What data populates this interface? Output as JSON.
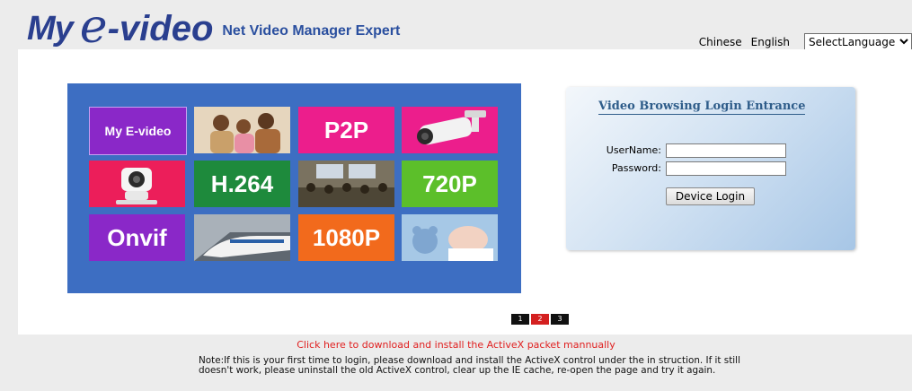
{
  "header": {
    "logo": {
      "my": "My",
      "e": "e",
      "video": "-video",
      "tagline": "Net Video Manager Expert"
    },
    "languages": [
      "Chinese",
      "English"
    ],
    "language_select": {
      "value": "SelectLanguage"
    }
  },
  "mosaic": {
    "tiles": [
      {
        "label": "My E-video",
        "color": "#8a28c8"
      },
      {
        "label": "",
        "icon": "family-photo-icon",
        "color": "#c9a07a"
      },
      {
        "label": "P2P",
        "color": "#ec1e8c"
      },
      {
        "label": "",
        "icon": "bullet-camera-icon",
        "color": "#ec1e8c"
      },
      {
        "label": "",
        "icon": "dome-camera-icon",
        "color": "#ec1e5a"
      },
      {
        "label": "H.264",
        "color": "#1e8a3c"
      },
      {
        "label": "",
        "icon": "conference-photo-icon",
        "color": "#6b6655"
      },
      {
        "label": "720P",
        "color": "#5cbf2a"
      },
      {
        "label": "Onvif",
        "color": "#8a28c8"
      },
      {
        "label": "",
        "icon": "train-photo-icon",
        "color": "#9aa2ab"
      },
      {
        "label": "1080P",
        "color": "#f26a1c"
      },
      {
        "label": "",
        "icon": "baby-photo-icon",
        "color": "#8fb6d9"
      }
    ],
    "pages": [
      "1",
      "2",
      "3"
    ],
    "active_page": 2
  },
  "login": {
    "title": "Video Browsing Login Entrance",
    "username_label": "UserName:",
    "username_value": "",
    "password_label": "Password:",
    "password_value": "",
    "button_label": "Device Login"
  },
  "download_link": "Click here to download and install the ActiveX packet mannually",
  "note": "Note:If this is your first time to login, please download and install the ActiveX control under the in struction. If it still doesn't work, please uninstall the old ActiveX control, clear up the IE cache, re-open the page and try it again."
}
